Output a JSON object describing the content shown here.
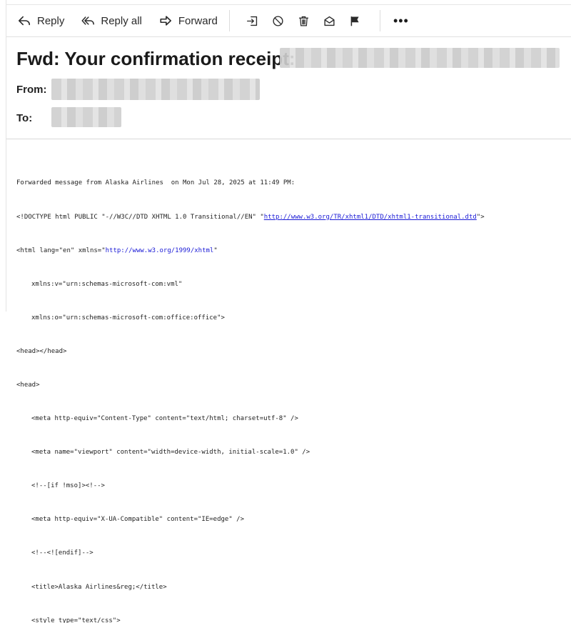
{
  "toolbar": {
    "reply_label": "Reply",
    "reply_all_label": "Reply all",
    "forward_label": "Forward",
    "icons": [
      "move-to-folder-icon",
      "block-icon",
      "trash-icon",
      "mark-unread-icon",
      "flag-icon",
      "more-icon"
    ],
    "more_label": "•••"
  },
  "header": {
    "subject": "Fwd: Your confirmation receipt:",
    "from_label": "From:",
    "to_label": "To:"
  },
  "body": {
    "forward_note": "Forwarded message from Alaska Airlines  on Mon Jul 28, 2025 at 11:49 PM:",
    "doctype_prefix": "<!DOCTYPE html PUBLIC \"-//W3C//DTD XHTML 1.0 Transitional//EN\" \"",
    "doctype_link": "http://www.w3.org/TR/xhtml1/DTD/xhtml1-transitional.dtd",
    "doctype_suffix": "\">",
    "html_prefix": "<html lang=\"en\" xmlns=\"",
    "html_link": "http://www.w3.org/1999/xhtml",
    "html_suffix": "\"",
    "xmlns_v": "xmlns:v=\"urn:schemas-microsoft-com:vml\"",
    "xmlns_o": "xmlns:o=\"urn:schemas-microsoft-com:office:office\">",
    "head_empty": "<head></head>",
    "head_open": "<head>",
    "meta_content_type": "<meta http-equiv=\"Content-Type\" content=\"text/html; charset=utf-8\" />",
    "meta_viewport": "<meta name=\"viewport\" content=\"width=device-width, initial-scale=1.0\" />",
    "if_mso": "<!--[if !mso]><!-->",
    "meta_xua": "<meta http-equiv=\"X-UA-Compatible\" content=\"IE=edge\" />",
    "endif": "<!--<![endif]-->",
    "title_tag": "<title>Alaska Airlines&reg;</title>",
    "style_tag": "<style type=\"text/css\">"
  }
}
